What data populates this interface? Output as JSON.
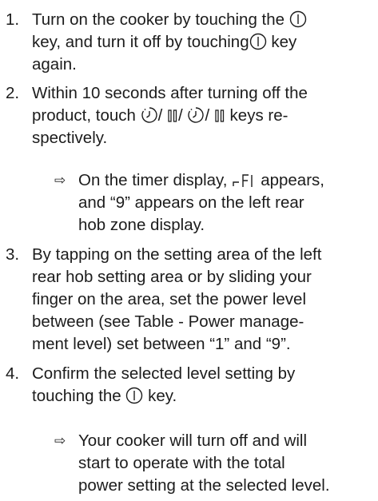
{
  "steps": [
    {
      "number": "1.",
      "parts": [
        "Turn on the cooker by touching the",
        "key, and turn it off by touching",
        "key",
        "again."
      ]
    },
    {
      "number": "2.",
      "parts": [
        "Within 10 seconds after turning off the",
        "product, touch",
        "/",
        "/",
        "/",
        "keys re-",
        "spectively."
      ],
      "result": {
        "arrow": "⇨",
        "parts": [
          "On the timer display,",
          "appears,",
          "and “9” appears on the left rear",
          "hob zone display."
        ]
      }
    },
    {
      "number": "3.",
      "lines": [
        "By tapping on the setting area of the left",
        "rear hob setting area or by sliding your",
        "finger on the area, set the power level",
        "between (see Table - Power manage-",
        "ment level) set between “1” and “9”."
      ]
    },
    {
      "number": "4.",
      "parts": [
        "Confirm the selected level setting by",
        "touching the",
        "key."
      ],
      "result": {
        "arrow": "⇨",
        "lines": [
          "Your cooker will turn off and will",
          "start to operate with the total",
          "power setting at the selected level."
        ]
      }
    }
  ],
  "icons": {
    "power": "power-key-icon",
    "timer": "timer-key-icon",
    "pause": "pause-key-icon",
    "display_code": "timer-display-code-icon"
  },
  "colors": {
    "text": "#1c1c1c",
    "background": "#ffffff"
  }
}
